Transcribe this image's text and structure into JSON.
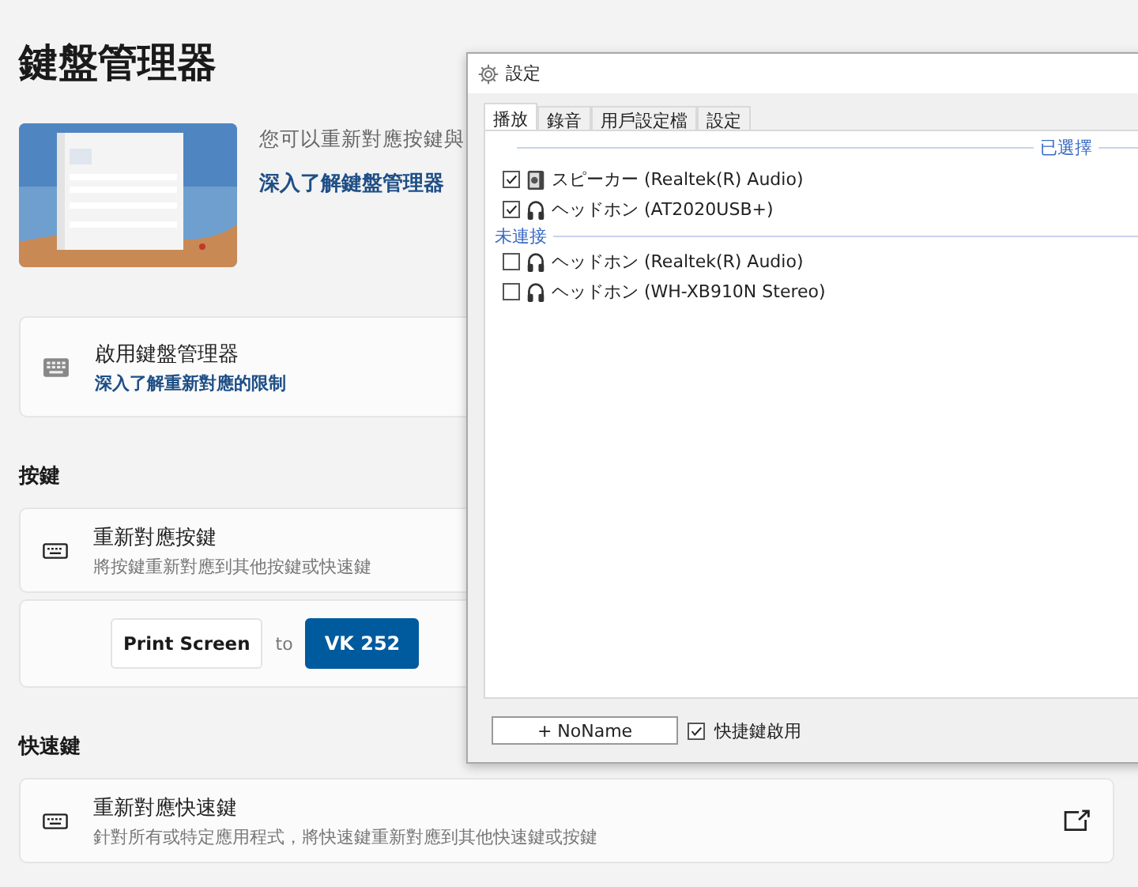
{
  "page": {
    "title": "鍵盤管理器",
    "description": "您可以重新對應按鍵與",
    "learn_more_link": "深入了解鍵盤管理器"
  },
  "enable_card": {
    "title": "啟用鍵盤管理器",
    "link": "深入了解重新對應的限制"
  },
  "sections": [
    {
      "heading": "按鍵",
      "card": {
        "title": "重新對應按鍵",
        "subtitle": "將按鍵重新對應到其他按鍵或快速鍵"
      },
      "mapping": {
        "from": "Print Screen",
        "joiner": "to",
        "to": "VK 252"
      }
    },
    {
      "heading": "快速鍵",
      "card": {
        "title": "重新對應快速鍵",
        "subtitle": "針對所有或特定應用程式，將快速鍵重新對應到其他快速鍵或按鍵",
        "external": true
      }
    }
  ],
  "settings_window": {
    "title": "設定",
    "tabs": [
      {
        "label": "播放",
        "selected": true
      },
      {
        "label": "錄音",
        "selected": false
      },
      {
        "label": "用戶設定檔",
        "selected": false
      },
      {
        "label": "設定",
        "selected": false
      }
    ],
    "groups": [
      {
        "label": "已選擇",
        "kind": "trailing",
        "devices": [
          {
            "name": "スピーカー (Realtek(R) Audio)",
            "kind": "speaker",
            "checked": true
          },
          {
            "name": "ヘッドホン (AT2020USB+)",
            "kind": "headphones",
            "checked": true
          }
        ]
      },
      {
        "label": "未連接",
        "kind": "leading",
        "devices": [
          {
            "name": "ヘッドホン (Realtek(R) Audio)",
            "kind": "headphones",
            "checked": false
          },
          {
            "name": "ヘッドホン (WH-XB910N Stereo)",
            "kind": "headphones",
            "checked": false
          }
        ]
      }
    ],
    "add_button": "+ NoName",
    "hotkey": {
      "label": "快捷鍵啟用",
      "checked": true
    }
  }
}
